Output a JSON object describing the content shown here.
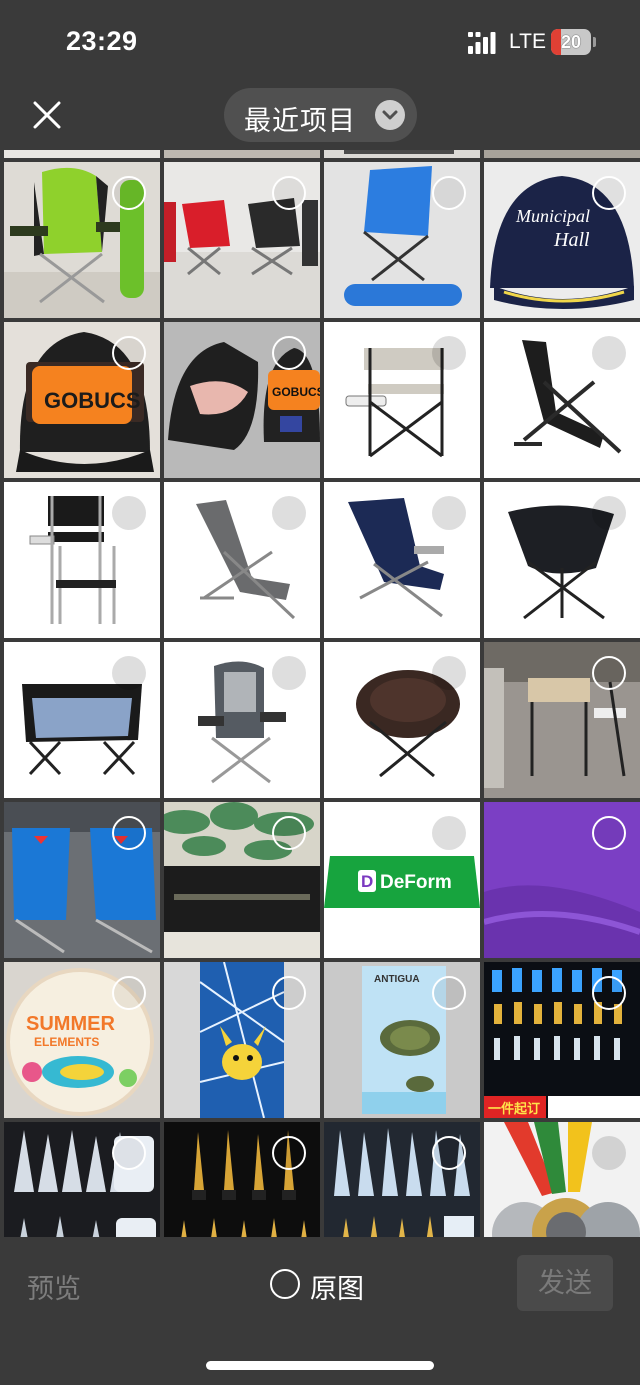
{
  "status_bar": {
    "time": "23:29",
    "network": "LTE",
    "battery": "20"
  },
  "nav": {
    "album_title": "最近项目",
    "close_icon": "close-icon",
    "dropdown_icon": "chevron-down-icon"
  },
  "photos": [
    {
      "subject": "partial"
    },
    {
      "subject": "partial"
    },
    {
      "subject": "partial"
    },
    {
      "subject": "partial"
    },
    {
      "subject": "green folding camp chair"
    },
    {
      "subject": "red and black folding chairs"
    },
    {
      "subject": "blue folding chair"
    },
    {
      "subject": "navy baseball cap",
      "text": "Municipal Hall"
    },
    {
      "subject": "orange patch trucker cap",
      "text": "GOBUCS"
    },
    {
      "subject": "two trucker caps",
      "text": "GOBUCS"
    },
    {
      "subject": "director chair with side table"
    },
    {
      "subject": "black zero gravity recliner"
    },
    {
      "subject": "tall director chair"
    },
    {
      "subject": "grey lounge chair"
    },
    {
      "subject": "navy beach chair"
    },
    {
      "subject": "black butterfly chair"
    },
    {
      "subject": "double loveseat camp chair"
    },
    {
      "subject": "grey padded camp chair"
    },
    {
      "subject": "brown moon chair"
    },
    {
      "subject": "director chairs in warehouse"
    },
    {
      "subject": "blue backpack beach chairs"
    },
    {
      "subject": "tropical leaf printed box"
    },
    {
      "subject": "green fitted table cover",
      "text": "DeForm"
    },
    {
      "subject": "purple yoga mat"
    },
    {
      "subject": "round beach towel",
      "text": "SUMMER ELEMENTS"
    },
    {
      "subject": "pikachu beach towel"
    },
    {
      "subject": "sea turtle beach towel",
      "text": "ANTIGUA"
    },
    {
      "subject": "trophy display wall",
      "text": "一件起订"
    },
    {
      "subject": "crystal trophies"
    },
    {
      "subject": "gold star trophies"
    },
    {
      "subject": "crystal award trophies"
    },
    {
      "subject": "medals with ribbons"
    }
  ],
  "bottom_bar": {
    "preview_label": "预览",
    "original_label": "原图",
    "send_label": "发送"
  },
  "colors": {
    "background": "#3a3a3a",
    "pill": "#505050",
    "battery_red": "#e04034"
  }
}
